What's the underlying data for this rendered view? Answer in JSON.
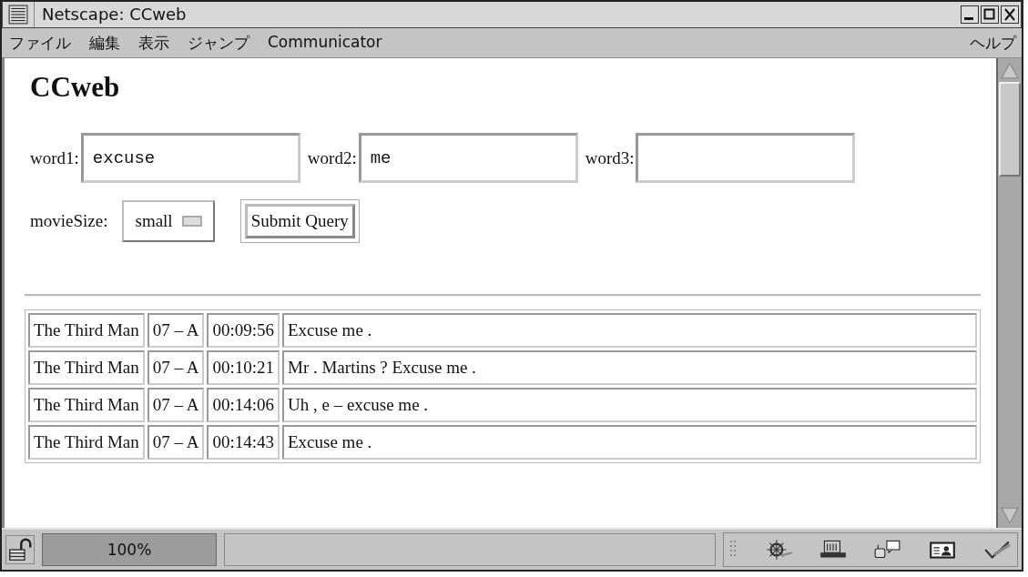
{
  "window": {
    "title": "Netscape: CCweb"
  },
  "menu": [
    "ファイル",
    "編集",
    "表示",
    "ジャンプ",
    "Communicator"
  ],
  "help_menu": "ヘルプ",
  "page": {
    "heading": "CCweb",
    "fields": [
      {
        "label": "word1:",
        "value": "excuse"
      },
      {
        "label": "word2:",
        "value": "me"
      },
      {
        "label": "word3:"
      }
    ],
    "movie_size": {
      "label": "movieSize:",
      "value": "small"
    },
    "submit": "Submit Query",
    "table": {
      "rows": [
        [
          "The Third Man",
          "07 – A",
          "00:09:56",
          "Excuse me ."
        ],
        [
          "The Third Man",
          "07 – A",
          "00:10:21",
          "Mr . Martins ? Excuse me ."
        ],
        [
          "The Third Man",
          "07 – A",
          "00:14:06",
          "Uh , e – excuse me ."
        ],
        [
          "The Third Man",
          "07 – A",
          "00:14:43",
          "Excuse me ."
        ]
      ]
    }
  },
  "status_bar": {
    "zoom": "100%"
  }
}
